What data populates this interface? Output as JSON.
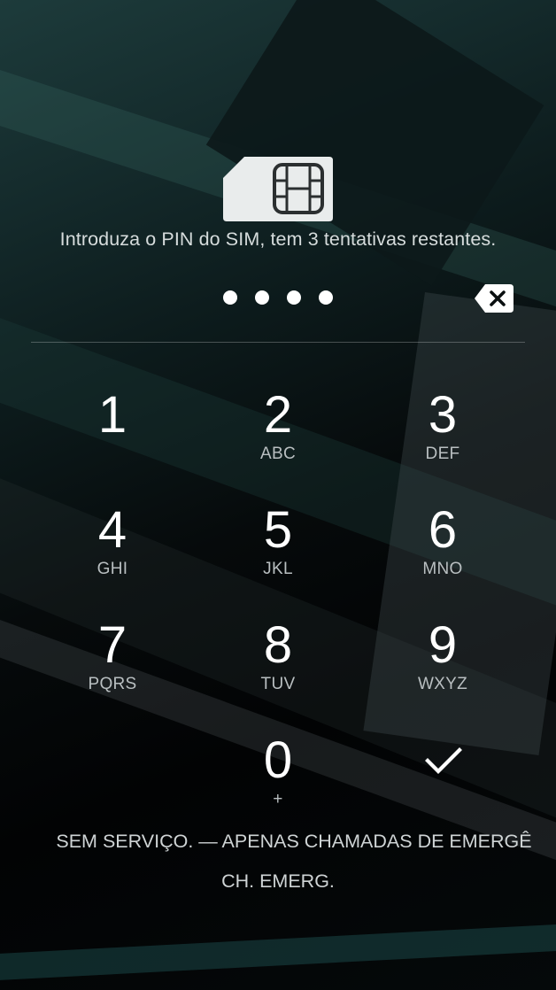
{
  "lock_screen": {
    "prompt": "Introduza o PIN do SIM, tem 3 tentativas restantes.",
    "pin_entered_length": 4,
    "keypad": [
      {
        "digit": "1",
        "letters": ""
      },
      {
        "digit": "2",
        "letters": "ABC"
      },
      {
        "digit": "3",
        "letters": "DEF"
      },
      {
        "digit": "4",
        "letters": "GHI"
      },
      {
        "digit": "5",
        "letters": "JKL"
      },
      {
        "digit": "6",
        "letters": "MNO"
      },
      {
        "digit": "7",
        "letters": "PQRS"
      },
      {
        "digit": "8",
        "letters": "TUV"
      },
      {
        "digit": "9",
        "letters": "WXYZ"
      },
      {
        "digit": "0",
        "letters": "+"
      }
    ],
    "status_text": "SEM SERVIÇO. — APENAS CHAMADAS DE EMERGÊ",
    "emergency_label": "CH. EMERG.",
    "icons": {
      "sim": "sim-card-icon",
      "backspace": "backspace-icon",
      "enter": "checkmark-icon"
    },
    "colors": {
      "text": "#ffffff",
      "secondary_text": "#b9bfc1",
      "accent_wallpaper": "#1d3b3b"
    }
  }
}
